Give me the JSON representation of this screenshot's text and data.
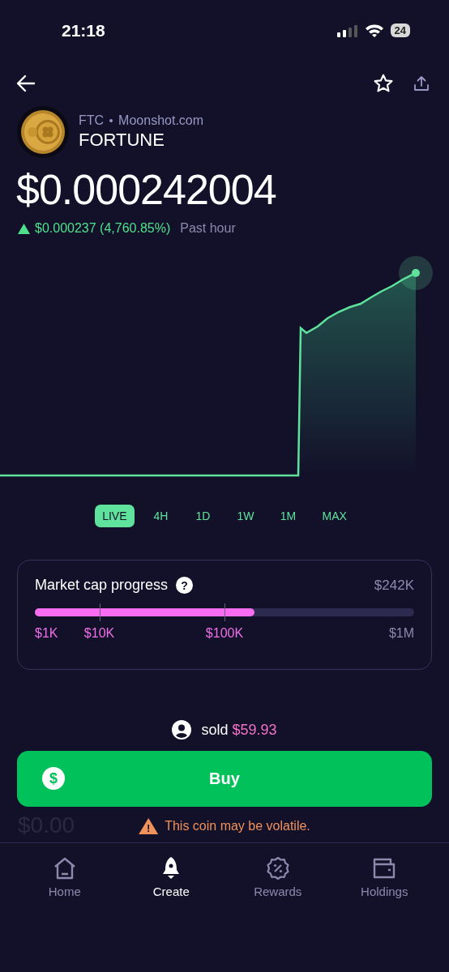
{
  "status_bar": {
    "time": "21:18",
    "battery": "24"
  },
  "coin": {
    "ticker": "FTC",
    "source": "Moonshot.com",
    "name": "FORTUNE"
  },
  "price": "$0.000242004",
  "change": {
    "amount": "$0.000237 (4,760.85%)",
    "period": "Past hour"
  },
  "ranges": [
    {
      "label": "LIVE",
      "selected": true
    },
    {
      "label": "4H",
      "selected": false
    },
    {
      "label": "1D",
      "selected": false
    },
    {
      "label": "1W",
      "selected": false
    },
    {
      "label": "1M",
      "selected": false
    },
    {
      "label": "MAX",
      "selected": false
    }
  ],
  "market_cap": {
    "title": "Market cap progress",
    "help": "?",
    "value": "$242K",
    "level": 0.58,
    "marks": [
      {
        "label": "$1K",
        "reached": true
      },
      {
        "label": "$10K",
        "reached": true
      },
      {
        "label": "$100K",
        "reached": true
      },
      {
        "label": "$1M",
        "reached": false
      }
    ]
  },
  "activity": {
    "action": "sold",
    "amount": "$59.93"
  },
  "holding_value": "$0.00",
  "buy_button": {
    "label": "Buy",
    "icon": "$"
  },
  "warning": {
    "icon": "!",
    "text": "This coin may be volatile."
  },
  "nav": [
    {
      "label": "Home",
      "selected": false,
      "kind": "home"
    },
    {
      "label": "Create",
      "selected": true,
      "kind": "rocket"
    },
    {
      "label": "Rewards",
      "selected": false,
      "kind": "badge"
    },
    {
      "label": "Holdings",
      "selected": false,
      "kind": "wallet"
    }
  ]
}
